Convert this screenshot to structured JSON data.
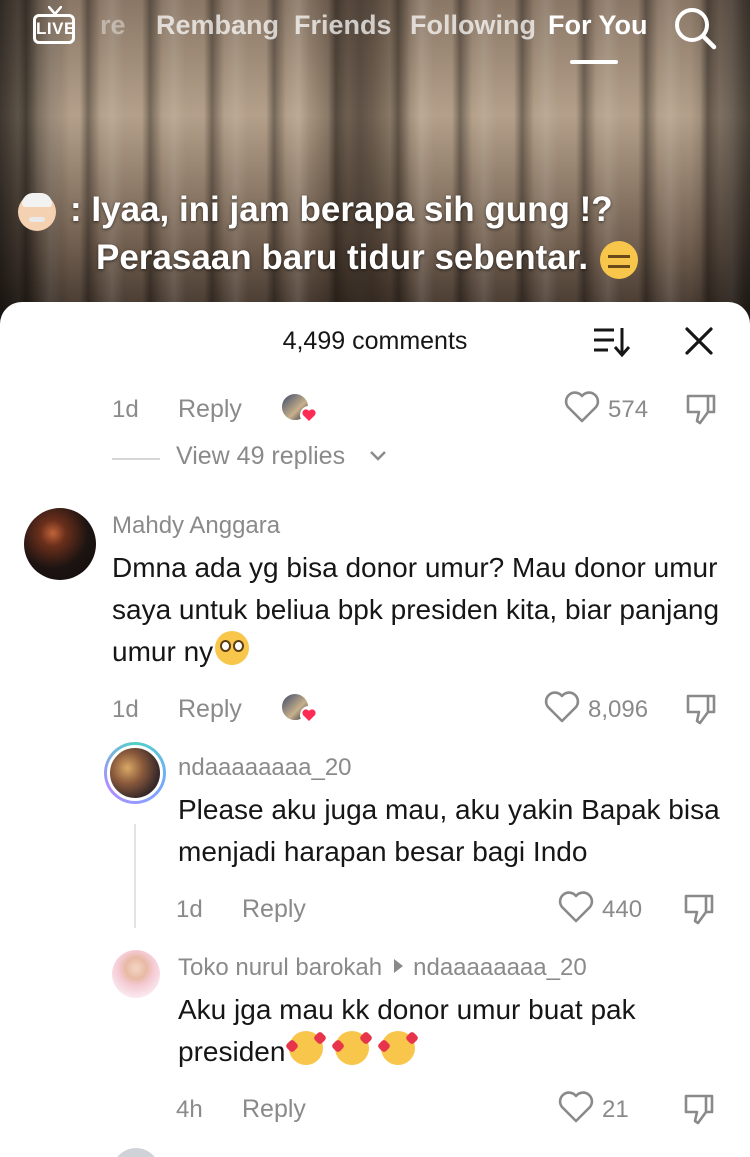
{
  "topbar": {
    "live_label": "LIVE",
    "tabs": [
      {
        "label": "re"
      },
      {
        "label": "Rembang"
      },
      {
        "label": "Friends"
      },
      {
        "label": "Following"
      },
      {
        "label": "For You"
      }
    ]
  },
  "caption": {
    "line1": ": Iyaa, ini jam berapa sih gung !?",
    "line2": "Perasaan baru tidur sebentar."
  },
  "sheet": {
    "title": "4,499 comments"
  },
  "comments": [
    {
      "time": "1d",
      "reply_label": "Reply",
      "likes": "574",
      "view_replies": "View 49 replies"
    },
    {
      "username": "Mahdy Anggara",
      "text": "Dmna ada yg bisa donor umur? Mau donor umur saya untuk beliua bpk presiden kita, biar panjang umur ny",
      "time": "1d",
      "reply_label": "Reply",
      "likes": "8,096"
    },
    {
      "username": "ndaaaaaaaa_20",
      "text": "Please aku juga mau, aku yakin Bapak bisa menjadi harapan besar bagi Indo",
      "time": "1d",
      "reply_label": "Reply",
      "likes": "440"
    },
    {
      "username": "Toko nurul barokah",
      "reply_to": "ndaaaaaaaa_20",
      "text": "Aku jga mau kk donor umur buat pak presiden",
      "time": "4h",
      "reply_label": "Reply",
      "likes": "21"
    }
  ],
  "colors": {
    "accent_heart": "#fe2c55",
    "text_secondary": "#8a8a8a"
  }
}
